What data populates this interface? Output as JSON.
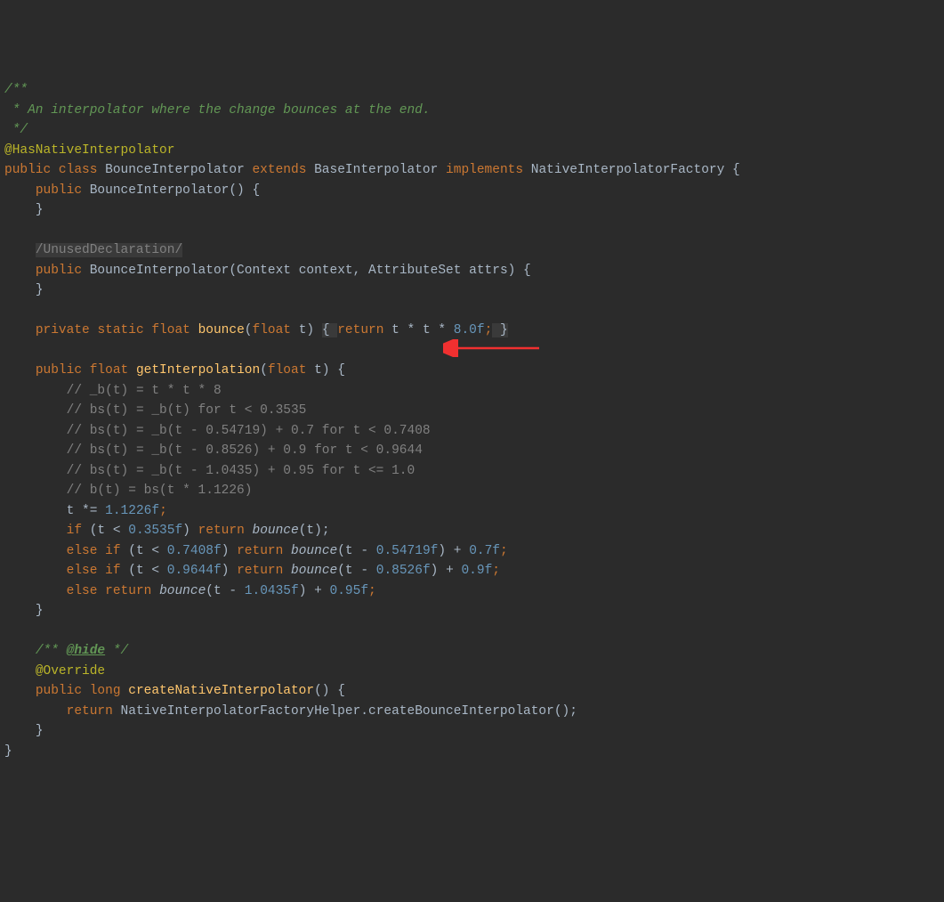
{
  "code": {
    "doc1": "/**",
    "doc2": " * An interpolator where the change bounces at the end.",
    "doc3": " */",
    "annotation1": "@HasNativeInterpolator",
    "kw_public": "public",
    "kw_class": "class",
    "cls_name": "BounceInterpolator",
    "kw_extends": "extends",
    "super_name": "BaseInterpolator",
    "kw_implements": "implements",
    "iface_name": "NativeInterpolatorFactory",
    "brace_open": "{",
    "brace_close": "}",
    "ctor1_sig": "BounceInterpolator() {",
    "suppress_text": "/UnusedDeclaration/",
    "ctor2_a": "BounceInterpolator(Context ",
    "ctor2_p1": "context",
    "comma": ", ",
    "ctor2_b": "AttributeSet ",
    "ctor2_p2": "attrs",
    "ctor2_c": ") {",
    "kw_private": "private",
    "kw_static": "static",
    "kw_float": "float",
    "bounce_name": "bounce",
    "bounce_sig_a": "(",
    "bounce_p": "t",
    "bounce_sig_b": ") ",
    "fold_open": "{ ",
    "kw_return": "return",
    "bounce_expr_a": " t * t * ",
    "num_8f": "8.0f",
    "semi": ";",
    "fold_close": " }",
    "gi_name": "getInterpolation",
    "gi_sig_a": "(",
    "gi_p": "t",
    "gi_sig_b": ") {",
    "cmt1": "// _b(t) = t * t * 8",
    "cmt2": "// bs(t) = _b(t) for t < 0.3535",
    "cmt3": "// bs(t) = _b(t - 0.54719) + 0.7 for t < 0.7408",
    "cmt4": "// bs(t) = _b(t - 0.8526) + 0.9 for t < 0.9644",
    "cmt5": "// bs(t) = _b(t - 1.0435) + 0.95 for t <= 1.0",
    "cmt6": "// b(t) = bs(t * 1.1226)",
    "stmt_mul_a": "t *= ",
    "num_11226": "1.1226f",
    "kw_if": "if",
    "kw_else": "else",
    "cond_a": " (t < ",
    "num_03535": "0.3535f",
    "paren_close_sp": ") ",
    "sp": " ",
    "bounce_call": "bounce",
    "call_t": "(t);",
    "num_07408": "0.7408f",
    "call_t_minus": "(t - ",
    "num_054719": "0.54719f",
    "plus": ") + ",
    "num_07f": "0.7f",
    "num_09644": "0.9644f",
    "num_08526": "0.8526f",
    "num_09f": "0.9f",
    "num_10435": "1.0435f",
    "num_095f": "0.95f",
    "doc_hide_a": "/** ",
    "doc_hide_tag": "@hide",
    "doc_hide_b": " */",
    "annotation2": "@Override",
    "kw_long": "long",
    "cni_name": "createNativeInterpolator",
    "cni_sig": "() {",
    "helper_cls": "NativeInterpolatorFactoryHelper",
    "helper_call": ".createBounceInterpolator();"
  },
  "arrow_color": "#f03030"
}
